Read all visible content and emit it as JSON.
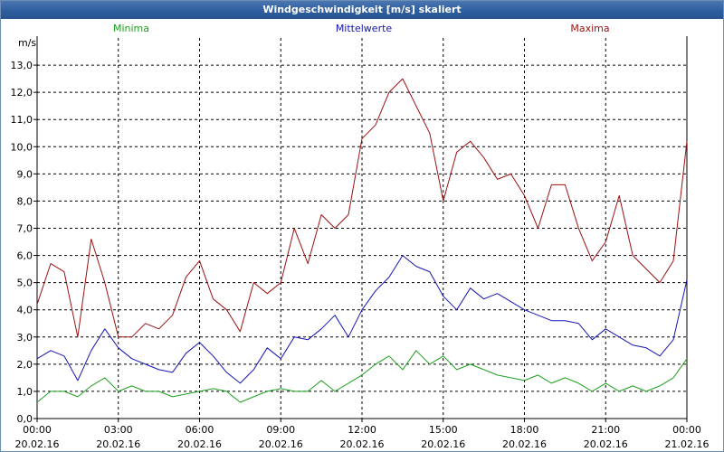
{
  "window": {
    "title": "Windgeschwindigkeit [m/s] skaliert"
  },
  "chart_data": {
    "type": "line",
    "ylabel": "m/s",
    "ylim": [
      0,
      14
    ],
    "xlim": [
      "2016-02-20 00:00",
      "2016-02-21 00:00"
    ],
    "y_ticks": [
      "0,0",
      "1,0",
      "2,0",
      "3,0",
      "4,0",
      "5,0",
      "6,0",
      "7,0",
      "8,0",
      "9,0",
      "10,0",
      "11,0",
      "12,0",
      "13,0"
    ],
    "x_ticks": [
      {
        "time": "00:00",
        "date": "20.02.16"
      },
      {
        "time": "03:00",
        "date": "20.02.16"
      },
      {
        "time": "06:00",
        "date": "20.02.16"
      },
      {
        "time": "09:00",
        "date": "20.02.16"
      },
      {
        "time": "12:00",
        "date": "20.02.16"
      },
      {
        "time": "15:00",
        "date": "20.02.16"
      },
      {
        "time": "18:00",
        "date": "20.02.16"
      },
      {
        "time": "21:00",
        "date": "20.02.16"
      },
      {
        "time": "00:00",
        "date": "21.02.16"
      }
    ],
    "grid": true,
    "x_hours": [
      0,
      0.5,
      1,
      1.5,
      2,
      2.5,
      3,
      3.5,
      4,
      4.5,
      5,
      5.5,
      6,
      6.5,
      7,
      7.5,
      8,
      8.5,
      9,
      9.5,
      10,
      10.5,
      11,
      11.5,
      12,
      12.5,
      13,
      13.5,
      14,
      14.5,
      15,
      15.5,
      16,
      16.5,
      17,
      17.5,
      18,
      18.5,
      19,
      19.5,
      20,
      20.5,
      21,
      21.5,
      22,
      22.5,
      23,
      23.5,
      24
    ],
    "series": [
      {
        "name": "Minima",
        "color": "#1fa01f",
        "values": [
          0.6,
          1.0,
          1.0,
          0.8,
          1.2,
          1.5,
          1.0,
          1.2,
          1.0,
          1.0,
          0.8,
          0.9,
          1.0,
          1.1,
          1.0,
          0.6,
          0.8,
          1.0,
          1.1,
          1.0,
          1.0,
          1.4,
          1.0,
          1.3,
          1.6,
          2.0,
          2.3,
          1.8,
          2.5,
          2.0,
          2.3,
          1.8,
          2.0,
          1.8,
          1.6,
          1.5,
          1.4,
          1.6,
          1.3,
          1.5,
          1.3,
          1.0,
          1.3,
          1.0,
          1.2,
          1.0,
          1.2,
          1.5,
          2.2
        ]
      },
      {
        "name": "Mittelwerte",
        "color": "#1515b5",
        "values": [
          2.2,
          2.5,
          2.3,
          1.4,
          2.5,
          3.3,
          2.6,
          2.2,
          2.0,
          1.8,
          1.7,
          2.4,
          2.8,
          2.3,
          1.7,
          1.3,
          1.8,
          2.6,
          2.2,
          3.0,
          2.9,
          3.3,
          3.8,
          3.0,
          4.0,
          4.7,
          5.2,
          6.0,
          5.6,
          5.4,
          4.5,
          4.0,
          4.8,
          4.4,
          4.6,
          4.3,
          4.0,
          3.8,
          3.6,
          3.6,
          3.5,
          2.9,
          3.3,
          3.0,
          2.7,
          2.6,
          2.3,
          2.9,
          5.1
        ]
      },
      {
        "name": "Maxima",
        "color": "#9b1111",
        "values": [
          4.2,
          5.7,
          5.4,
          3.0,
          6.6,
          5.0,
          3.0,
          3.0,
          3.5,
          3.3,
          3.8,
          5.2,
          5.8,
          4.4,
          4.0,
          3.2,
          5.0,
          4.6,
          5.0,
          7.0,
          5.7,
          7.5,
          7.0,
          7.5,
          10.3,
          10.8,
          12.0,
          12.5,
          11.5,
          10.5,
          8.0,
          9.8,
          10.2,
          9.6,
          8.8,
          9.0,
          8.2,
          7.0,
          8.6,
          8.6,
          7.0,
          5.8,
          6.5,
          8.2,
          6.0,
          5.5,
          5.0,
          5.8,
          10.2
        ]
      }
    ]
  }
}
